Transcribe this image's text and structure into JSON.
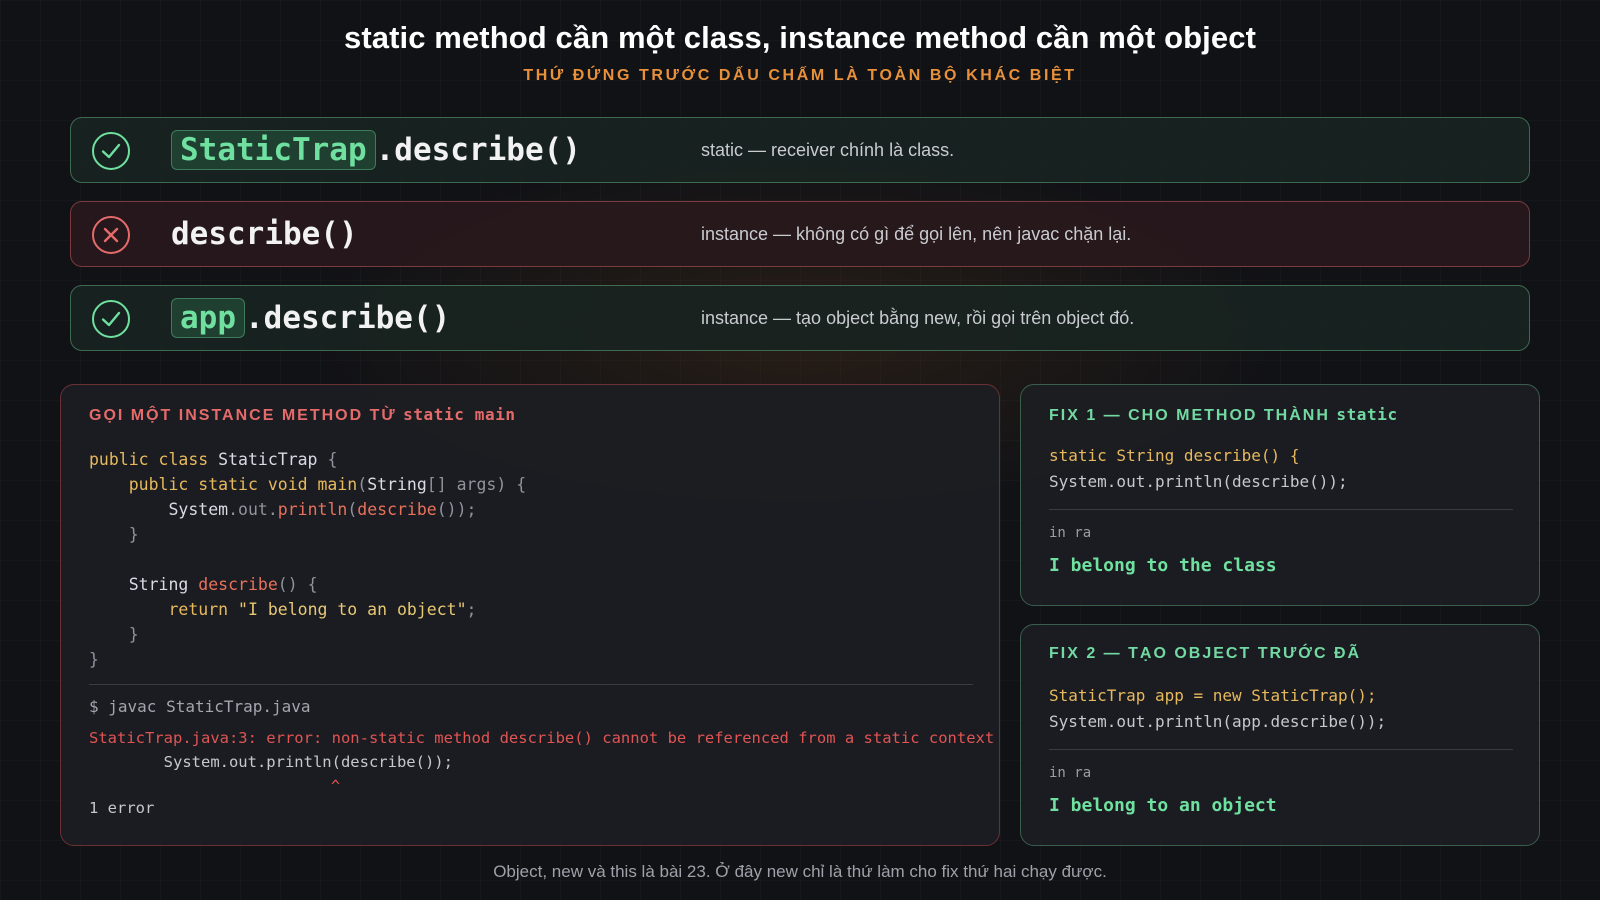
{
  "header": {
    "title": "static method cần một class, instance method cần một object",
    "subtitle": "THỨ ĐỨNG TRƯỚC DẤU CHẤM LÀ TOÀN BỘ KHÁC BIỆT"
  },
  "rows": [
    {
      "status": "check-icon",
      "receiver": "StaticTrap",
      "call": ".describe()",
      "desc": "static — receiver chính là class."
    },
    {
      "status": "cross-icon",
      "receiver": "",
      "call": "describe()",
      "desc": "instance — không có gì để gọi lên, nên javac chặn lại."
    },
    {
      "status": "check-icon",
      "receiver": "app",
      "call": ".describe()",
      "desc": "instance — tạo object bằng new, rồi gọi trên object đó."
    }
  ],
  "error_panel": {
    "heading": "GỌI MỘT INSTANCE METHOD TỪ",
    "heading_code": "static main",
    "code": {
      "l1_kw": "public class",
      "l1_name": "StaticTrap",
      "l1_brace": "{",
      "l2_kw": "public static void",
      "l2_fn": "main",
      "l2_open": "(",
      "l2_type": "String",
      "l2_arr": "[]",
      "l2_arg": "args",
      "l2_close": ") {",
      "l3_obj": "System",
      "l3_dot1": ".",
      "l3_field": "out",
      "l3_dot2": ".",
      "l3_fn": "println",
      "l3_open": "(",
      "l3_call": "describe",
      "l3_close": "());",
      "l4": "}",
      "l6_type": "String",
      "l6_fn": "describe",
      "l6_rest": "() {",
      "l7_kw": "return",
      "l7_str": "\"I belong to an object\"",
      "l7_semi": ";",
      "l8": "}",
      "l9": "}"
    },
    "terminal": {
      "command": "$ javac StaticTrap.java",
      "error": "StaticTrap.java:3: error: non-static method describe() cannot be referenced from a static context",
      "source_line": "        System.out.println(describe());",
      "caret": "^",
      "count": "1 error"
    }
  },
  "fix1": {
    "heading": "FIX 1 — CHO METHOD THÀNH",
    "heading_code": "static",
    "code_l1": "static String describe() {",
    "code_l2": "System.out.println(describe());",
    "output_label": "in ra",
    "output": "I belong to the class"
  },
  "fix2": {
    "heading": "FIX 2 — TẠO OBJECT TRƯỚC ĐÃ",
    "code_l1": "StaticTrap app = new StaticTrap();",
    "code_l2": "System.out.println(app.describe());",
    "output_label": "in ra",
    "output": "I belong to an object"
  },
  "footer": "Object, new và this là bài 23. Ở đây new chỉ là thứ làm cho fix thứ hai chạy được.",
  "colors": {
    "accent_orange": "#e8903a",
    "ok_green": "#6fe0a0",
    "error_red": "#e05454"
  }
}
